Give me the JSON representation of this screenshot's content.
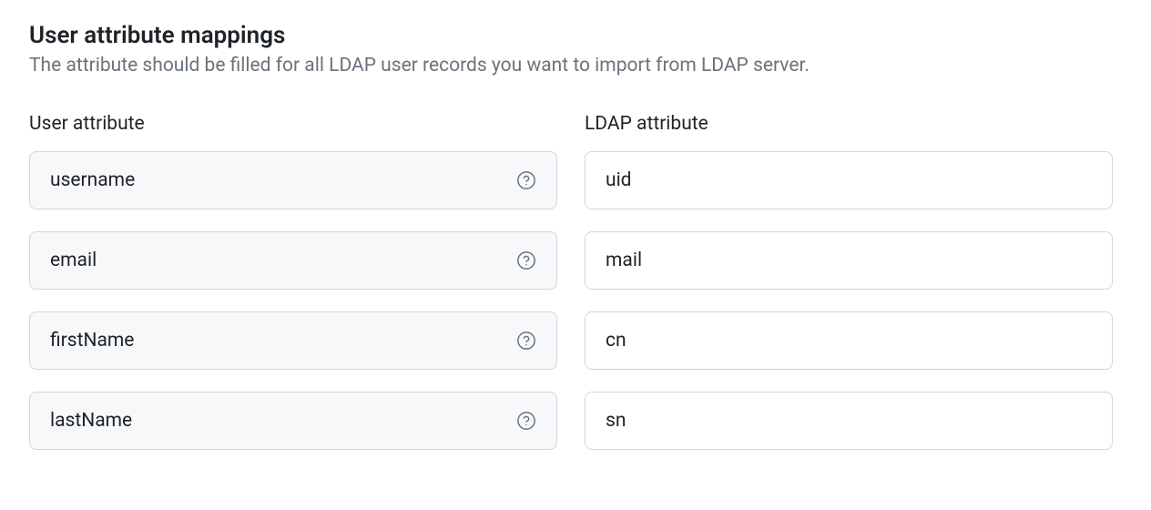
{
  "section": {
    "title": "User attribute mappings",
    "description": "The attribute should be filled for all LDAP user records you want to import from LDAP server."
  },
  "columns": {
    "user_attribute": "User attribute",
    "ldap_attribute": "LDAP attribute"
  },
  "mappings": [
    {
      "user_attribute": "username",
      "ldap_attribute": "uid"
    },
    {
      "user_attribute": "email",
      "ldap_attribute": "mail"
    },
    {
      "user_attribute": "firstName",
      "ldap_attribute": "cn"
    },
    {
      "user_attribute": "lastName",
      "ldap_attribute": "sn"
    }
  ]
}
